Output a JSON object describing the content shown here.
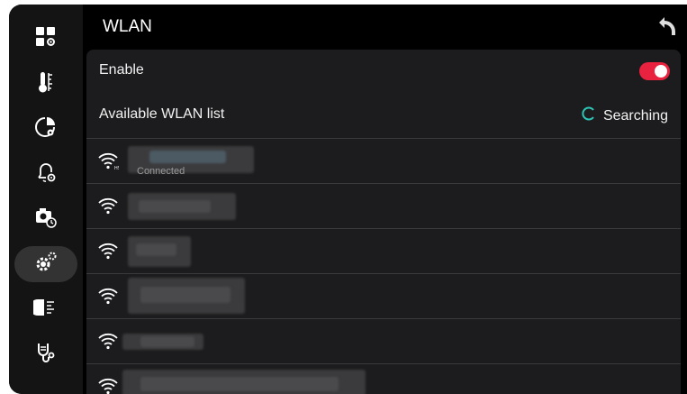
{
  "header": {
    "title": "WLAN"
  },
  "sidebar": {
    "items": [
      {
        "icon": "apps-settings-icon"
      },
      {
        "icon": "thermometer-icon"
      },
      {
        "icon": "pie-settings-icon"
      },
      {
        "icon": "bell-settings-icon"
      },
      {
        "icon": "camera-timer-icon"
      },
      {
        "icon": "gears-icon",
        "active": true
      },
      {
        "icon": "signal-icon"
      },
      {
        "icon": "stethoscope-icon"
      }
    ]
  },
  "settings": {
    "enable_label": "Enable",
    "enable_on": true,
    "list_label": "Available WLAN list",
    "status": "Searching"
  },
  "networks": [
    {
      "subtitle": "Connected"
    },
    {
      "subtitle": ""
    },
    {
      "subtitle": ""
    },
    {
      "subtitle": ""
    },
    {
      "subtitle": ""
    },
    {
      "subtitle": ""
    }
  ],
  "colors": {
    "accent": "#e8223f",
    "spinner": "#2ec4b6",
    "panel": "#1c1c1e",
    "sidebar": "#141414"
  }
}
